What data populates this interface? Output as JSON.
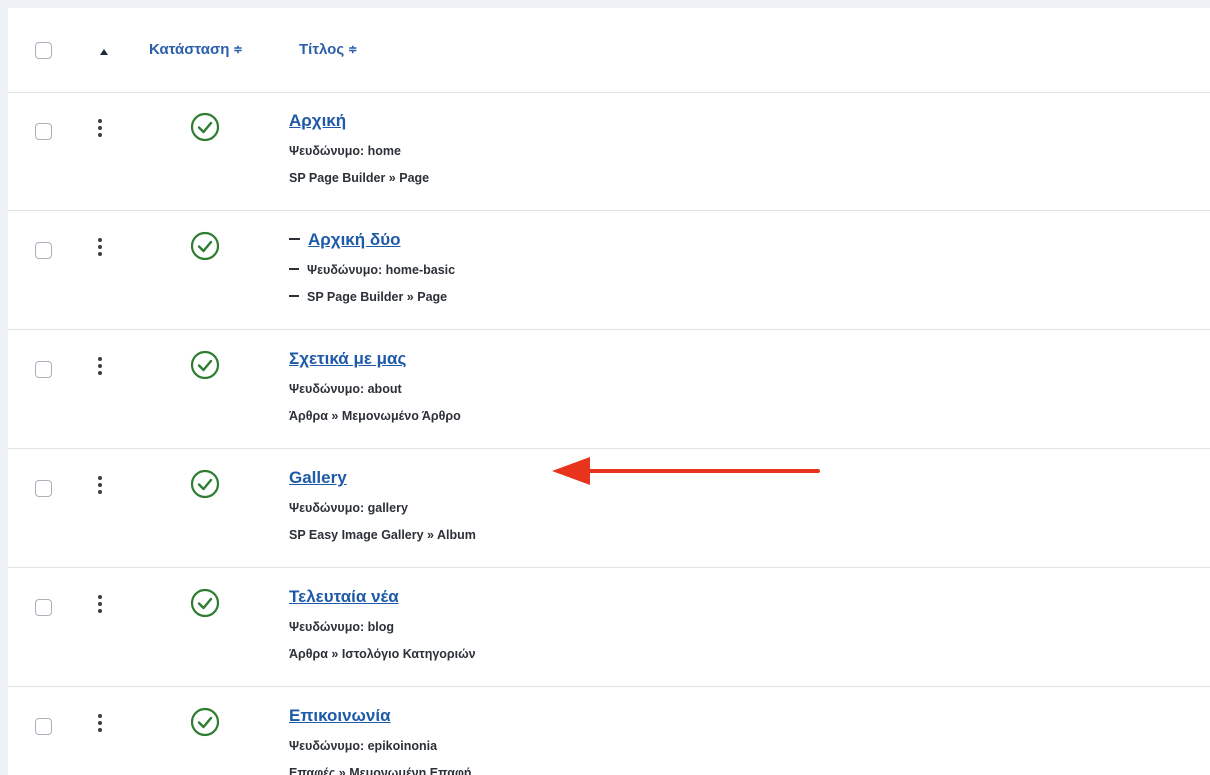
{
  "table": {
    "header": {
      "status_label": "Κατάσταση",
      "title_label": "Τίτλος",
      "sort_arrows": "≑"
    },
    "rows": [
      {
        "title": "Αρχική",
        "alias_label": "Ψευδώνυμο: home",
        "type": "SP Page Builder » Page",
        "status": "published",
        "nested": false
      },
      {
        "title": "Αρχική δύο",
        "alias_label": "Ψευδώνυμο: home-basic",
        "type": "SP Page Builder » Page",
        "status": "published",
        "nested": true
      },
      {
        "title": "Σχετικά με μας",
        "alias_label": "Ψευδώνυμο: about",
        "type": "Άρθρα » Μεμονωμένο Άρθρο",
        "status": "published",
        "nested": false
      },
      {
        "title": "Gallery",
        "alias_label": "Ψευδώνυμο: gallery",
        "type": "SP Easy Image Gallery » Album",
        "status": "published",
        "nested": false
      },
      {
        "title": "Τελευταία νέα",
        "alias_label": "Ψευδώνυμο: blog",
        "type": "Άρθρα » Ιστολόγιο Κατηγοριών",
        "status": "published",
        "nested": false
      },
      {
        "title": "Επικοινωνία",
        "alias_label": "Ψευδώνυμο: epikoinonia",
        "type": "Επαφές » Μεμονωμένη Επαφή",
        "status": "published",
        "nested": false
      }
    ]
  },
  "colors": {
    "link": "#1e5aa8",
    "published_check": "#2e7d32",
    "annotation_arrow": "#e8341c"
  },
  "icons": {
    "status": "check-circle-icon",
    "row_menu": "vertical-dots-icon",
    "sort": "sort-caret-up-icon",
    "annotation": "red-arrow-left"
  }
}
